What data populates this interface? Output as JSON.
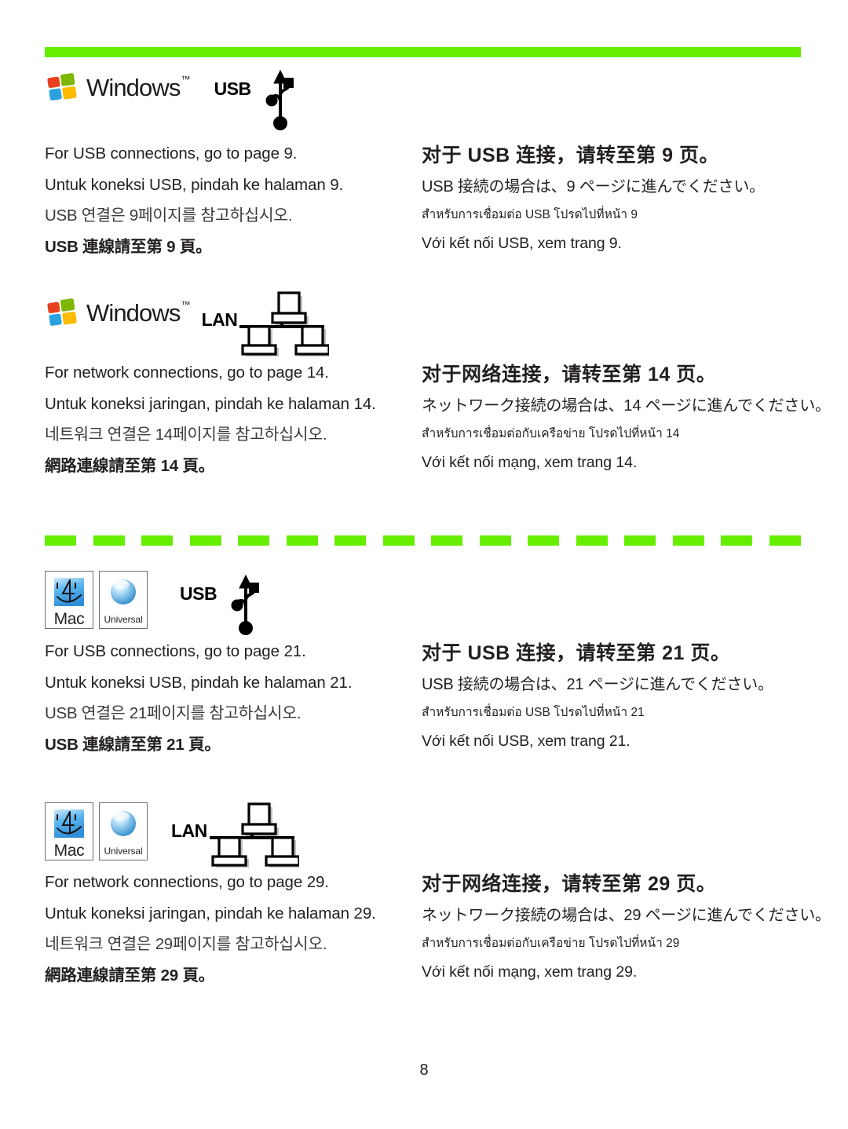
{
  "page": {
    "folio": "8",
    "accent_green": "#66ee00",
    "text_color": "#231f20"
  },
  "rules": {
    "solid_dash_count": 16
  },
  "blocks": [
    {
      "platform_name": "Windows",
      "platform_logo": "windows-logo",
      "platform_trademark": "™",
      "connector_label": "USB",
      "connector_icon": "usb-icon",
      "left": {
        "en": "For USB connections, go to page 9.",
        "id": "Untuk koneksi USB, pindah ke halaman 9.",
        "ko": "USB 연결은 9페이지를 참고하십시오.",
        "zh_hant": "USB 連線請至第 9 頁。"
      },
      "right": {
        "zh_hans": "对于 USB 连接，请转至第 9 页。",
        "ja": "USB 接続の場合は、9 ページに進んでください。",
        "th": "สำหรับการเชื่อมต่อ USB โปรดไปที่หน้า 9",
        "vi": "Với kết nối USB, xem trang 9."
      }
    },
    {
      "platform_name": "Windows",
      "platform_logo": "windows-logo",
      "platform_trademark": "™",
      "connector_label": "LAN",
      "connector_icon": "lan-icon",
      "left": {
        "en": "For network connections, go to page 14.",
        "id": "Untuk koneksi jaringan, pindah ke halaman 14.",
        "ko": "네트워크 연결은 14페이지를 참고하십시오.",
        "zh_hant": "網路連線請至第 14 頁。"
      },
      "right": {
        "zh_hans": "对于网络连接，请转至第 14 页。",
        "ja": "ネットワーク接続の場合は、14 ページに進んでください。",
        "th": "สำหรับการเชื่อมต่อกับเครือข่าย โปรดไปที่หน้า 14",
        "vi": "Với kết nối mạng, xem trang 14."
      }
    },
    {
      "platform_name": "Mac",
      "platform_logo": "mac-finder-icon",
      "platform_badge_2": "Universal",
      "connector_label": "USB",
      "connector_icon": "usb-icon",
      "left": {
        "en": "For USB connections, go to page 21.",
        "id": "Untuk koneksi USB, pindah ke halaman 21.",
        "ko": "USB 연결은 21페이지를 참고하십시오.",
        "zh_hant": "USB 連線請至第 21 頁。"
      },
      "right": {
        "zh_hans": "对于 USB 连接，请转至第 21 页。",
        "ja": "USB 接続の場合は、21 ページに進んでください。",
        "th": "สำหรับการเชื่อมต่อ USB โปรดไปที่หน้า 21",
        "vi": "Với kết nối USB, xem trang 21."
      }
    },
    {
      "platform_name": "Mac",
      "platform_logo": "mac-finder-icon",
      "platform_badge_2": "Universal",
      "connector_label": "LAN",
      "connector_icon": "lan-icon",
      "left": {
        "en": "For network connections, go to page 29.",
        "id": "Untuk koneksi jaringan, pindah ke halaman 29.",
        "ko": "네트워크 연결은 29페이지를 참고하십시오.",
        "zh_hant": "網路連線請至第 29 頁。"
      },
      "right": {
        "zh_hans": "对于网络连接，请转至第 29 页。",
        "ja": "ネットワーク接続の場合は、29 ページに進んでください。",
        "th": "สำหรับการเชื่อมต่อกับเครือข่าย โปรดไปที่หน้า 29",
        "vi": "Với kết nối mạng, xem trang 29."
      }
    }
  ]
}
